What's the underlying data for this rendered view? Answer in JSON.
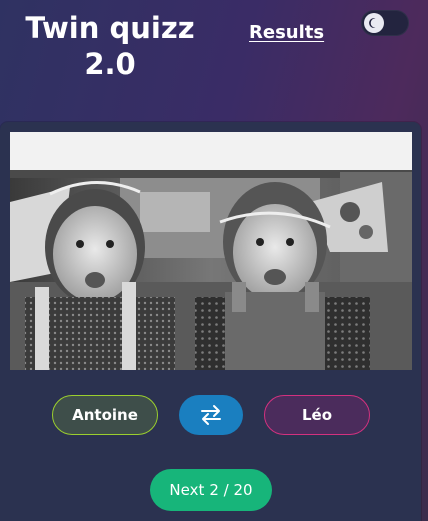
{
  "header": {
    "title_line1": "Twin quizz",
    "title_line2": "2.0",
    "results_label": "Results",
    "theme_toggle_icon": "moon-icon"
  },
  "quiz": {
    "photo_icon": "twins-photo",
    "choices": [
      {
        "label": "Antoine",
        "accent": "#9bcf2e"
      },
      {
        "label": "Léo",
        "accent": "#d3317f"
      }
    ],
    "swap_icon": "swap-arrows-icon",
    "next_label": "Next",
    "progress_text": "2 / 20",
    "progress_current": 2,
    "progress_total": 20
  },
  "colors": {
    "swap_button": "#1a7fc0",
    "next_button": "#17b57a",
    "card_background": "#2b3250"
  }
}
